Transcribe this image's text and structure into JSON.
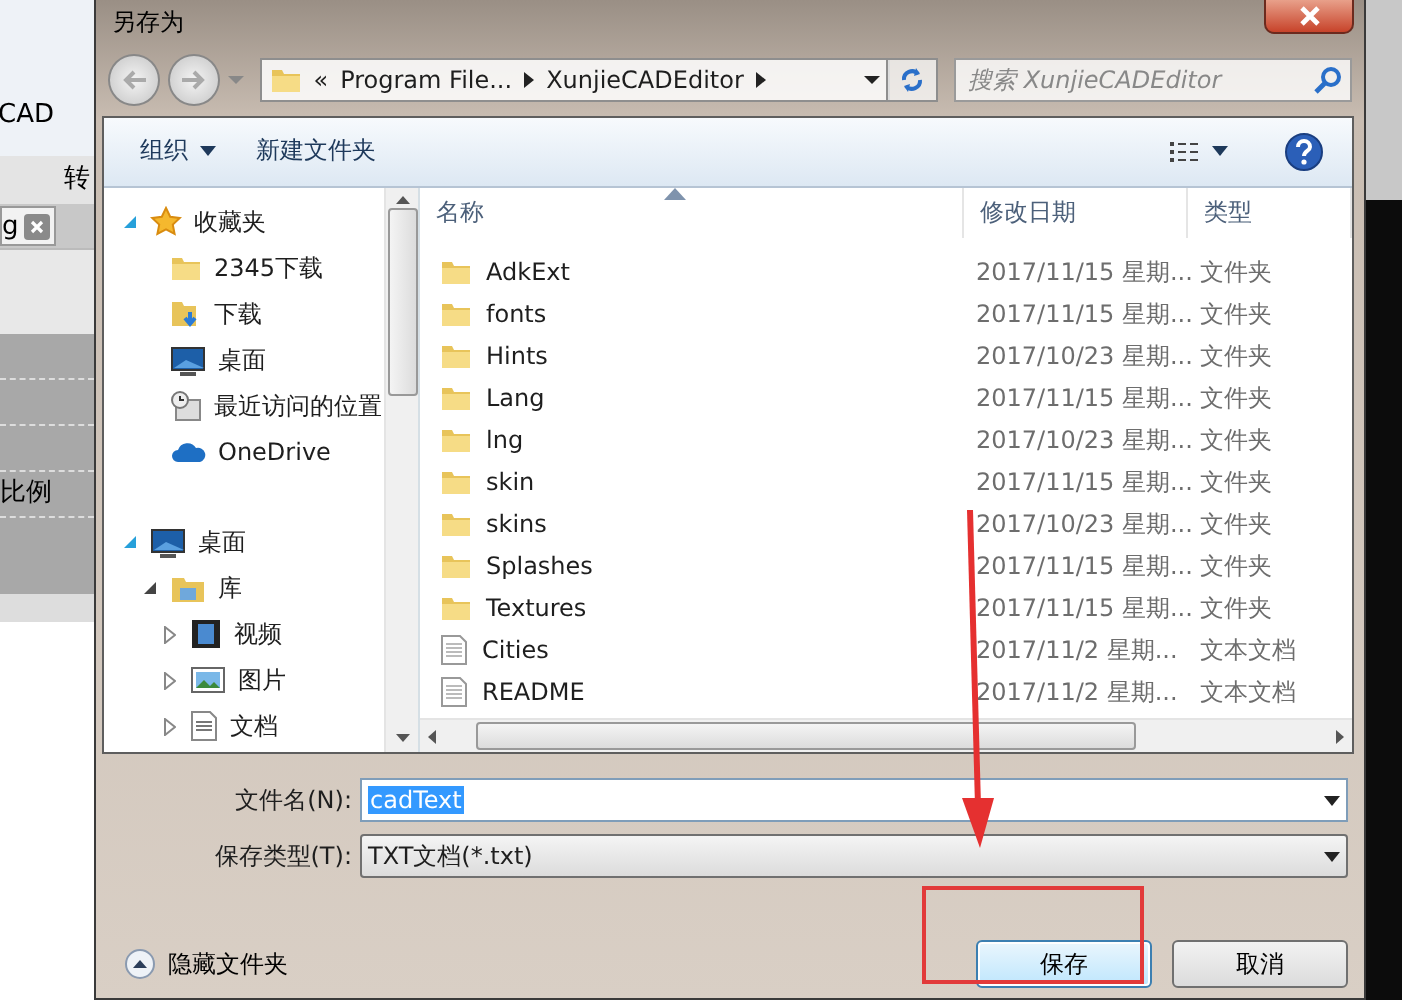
{
  "background_app": {
    "texts": [
      "CAD",
      "转",
      "比例"
    ],
    "tab": {
      "label": "g"
    }
  },
  "dialog": {
    "title": "另存为",
    "address": {
      "overflow": "«",
      "segments": [
        "Program File...",
        "XunjieCADEditor"
      ]
    },
    "search": {
      "placeholder": "搜索 XunjieCADEditor"
    },
    "toolbar": {
      "organize": "组织",
      "new_folder": "新建文件夹"
    },
    "nav_pane": {
      "items": [
        {
          "label": "收藏夹",
          "kind": "star",
          "expanded": true,
          "children": [
            {
              "label": "2345下载",
              "kind": "folder"
            },
            {
              "label": "下载",
              "kind": "download"
            },
            {
              "label": "桌面",
              "kind": "desktop"
            },
            {
              "label": "最近访问的位置",
              "kind": "recent"
            },
            {
              "label": "OneDrive",
              "kind": "cloud"
            }
          ]
        },
        {
          "label": "桌面",
          "kind": "desktop",
          "expanded": true,
          "children": [
            {
              "label": "库",
              "kind": "library",
              "expanded": true,
              "children": [
                {
                  "label": "视频",
                  "kind": "video",
                  "expanded": false
                },
                {
                  "label": "图片",
                  "kind": "picture",
                  "expanded": false
                },
                {
                  "label": "文档",
                  "kind": "document",
                  "expanded": false
                }
              ]
            }
          ]
        }
      ]
    },
    "file_list": {
      "columns": [
        {
          "label": "名称",
          "sorted": true
        },
        {
          "label": "修改日期"
        },
        {
          "label": "类型"
        }
      ],
      "rows": [
        {
          "name": "AdkExt",
          "modified": "2017/11/15 星期...",
          "type": "文件夹",
          "kind": "folder"
        },
        {
          "name": "fonts",
          "modified": "2017/11/15 星期...",
          "type": "文件夹",
          "kind": "folder"
        },
        {
          "name": "Hints",
          "modified": "2017/10/23 星期...",
          "type": "文件夹",
          "kind": "folder"
        },
        {
          "name": "Lang",
          "modified": "2017/11/15 星期...",
          "type": "文件夹",
          "kind": "folder"
        },
        {
          "name": "lng",
          "modified": "2017/10/23 星期...",
          "type": "文件夹",
          "kind": "folder"
        },
        {
          "name": "skin",
          "modified": "2017/11/15 星期...",
          "type": "文件夹",
          "kind": "folder"
        },
        {
          "name": "skins",
          "modified": "2017/10/23 星期...",
          "type": "文件夹",
          "kind": "folder"
        },
        {
          "name": "Splashes",
          "modified": "2017/11/15 星期...",
          "type": "文件夹",
          "kind": "folder"
        },
        {
          "name": "Textures",
          "modified": "2017/11/15 星期...",
          "type": "文件夹",
          "kind": "folder"
        },
        {
          "name": "Cities",
          "modified": "2017/11/2 星期...",
          "type": "文本文档",
          "kind": "text"
        },
        {
          "name": "README",
          "modified": "2017/11/2 星期...",
          "type": "文本文档",
          "kind": "text"
        }
      ]
    },
    "file_name": {
      "label": "文件名(N):",
      "value": "cadText",
      "text_selected": true
    },
    "file_type": {
      "label": "保存类型(T):",
      "value": "TXT文档(*.txt)"
    },
    "hide_folders": "隐藏文件夹",
    "buttons": [
      {
        "label": "保存",
        "highlighted": true
      },
      {
        "label": "取消",
        "highlighted": false
      }
    ]
  }
}
